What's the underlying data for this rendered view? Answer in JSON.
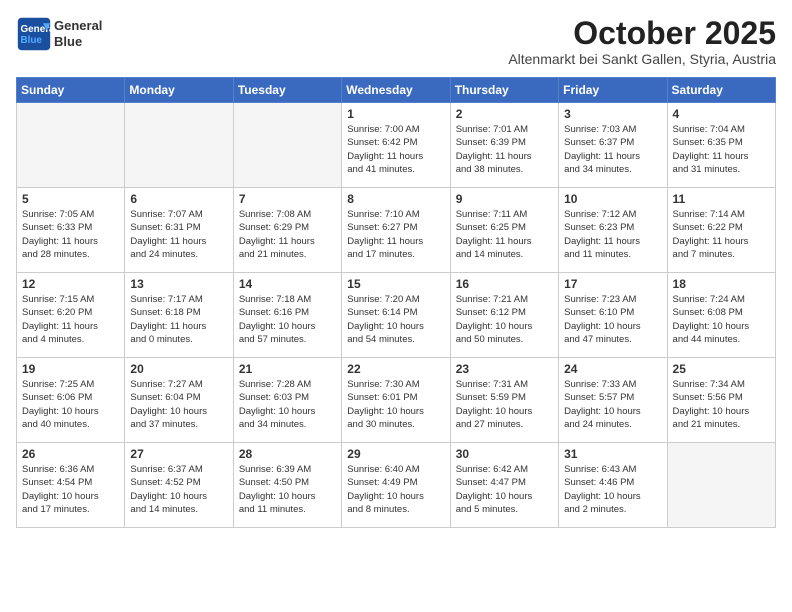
{
  "header": {
    "logo_line1": "General",
    "logo_line2": "Blue",
    "month_year": "October 2025",
    "location": "Altenmarkt bei Sankt Gallen, Styria, Austria"
  },
  "weekdays": [
    "Sunday",
    "Monday",
    "Tuesday",
    "Wednesday",
    "Thursday",
    "Friday",
    "Saturday"
  ],
  "weeks": [
    [
      {
        "day": "",
        "info": ""
      },
      {
        "day": "",
        "info": ""
      },
      {
        "day": "",
        "info": ""
      },
      {
        "day": "1",
        "info": "Sunrise: 7:00 AM\nSunset: 6:42 PM\nDaylight: 11 hours\nand 41 minutes."
      },
      {
        "day": "2",
        "info": "Sunrise: 7:01 AM\nSunset: 6:39 PM\nDaylight: 11 hours\nand 38 minutes."
      },
      {
        "day": "3",
        "info": "Sunrise: 7:03 AM\nSunset: 6:37 PM\nDaylight: 11 hours\nand 34 minutes."
      },
      {
        "day": "4",
        "info": "Sunrise: 7:04 AM\nSunset: 6:35 PM\nDaylight: 11 hours\nand 31 minutes."
      }
    ],
    [
      {
        "day": "5",
        "info": "Sunrise: 7:05 AM\nSunset: 6:33 PM\nDaylight: 11 hours\nand 28 minutes."
      },
      {
        "day": "6",
        "info": "Sunrise: 7:07 AM\nSunset: 6:31 PM\nDaylight: 11 hours\nand 24 minutes."
      },
      {
        "day": "7",
        "info": "Sunrise: 7:08 AM\nSunset: 6:29 PM\nDaylight: 11 hours\nand 21 minutes."
      },
      {
        "day": "8",
        "info": "Sunrise: 7:10 AM\nSunset: 6:27 PM\nDaylight: 11 hours\nand 17 minutes."
      },
      {
        "day": "9",
        "info": "Sunrise: 7:11 AM\nSunset: 6:25 PM\nDaylight: 11 hours\nand 14 minutes."
      },
      {
        "day": "10",
        "info": "Sunrise: 7:12 AM\nSunset: 6:23 PM\nDaylight: 11 hours\nand 11 minutes."
      },
      {
        "day": "11",
        "info": "Sunrise: 7:14 AM\nSunset: 6:22 PM\nDaylight: 11 hours\nand 7 minutes."
      }
    ],
    [
      {
        "day": "12",
        "info": "Sunrise: 7:15 AM\nSunset: 6:20 PM\nDaylight: 11 hours\nand 4 minutes."
      },
      {
        "day": "13",
        "info": "Sunrise: 7:17 AM\nSunset: 6:18 PM\nDaylight: 11 hours\nand 0 minutes."
      },
      {
        "day": "14",
        "info": "Sunrise: 7:18 AM\nSunset: 6:16 PM\nDaylight: 10 hours\nand 57 minutes."
      },
      {
        "day": "15",
        "info": "Sunrise: 7:20 AM\nSunset: 6:14 PM\nDaylight: 10 hours\nand 54 minutes."
      },
      {
        "day": "16",
        "info": "Sunrise: 7:21 AM\nSunset: 6:12 PM\nDaylight: 10 hours\nand 50 minutes."
      },
      {
        "day": "17",
        "info": "Sunrise: 7:23 AM\nSunset: 6:10 PM\nDaylight: 10 hours\nand 47 minutes."
      },
      {
        "day": "18",
        "info": "Sunrise: 7:24 AM\nSunset: 6:08 PM\nDaylight: 10 hours\nand 44 minutes."
      }
    ],
    [
      {
        "day": "19",
        "info": "Sunrise: 7:25 AM\nSunset: 6:06 PM\nDaylight: 10 hours\nand 40 minutes."
      },
      {
        "day": "20",
        "info": "Sunrise: 7:27 AM\nSunset: 6:04 PM\nDaylight: 10 hours\nand 37 minutes."
      },
      {
        "day": "21",
        "info": "Sunrise: 7:28 AM\nSunset: 6:03 PM\nDaylight: 10 hours\nand 34 minutes."
      },
      {
        "day": "22",
        "info": "Sunrise: 7:30 AM\nSunset: 6:01 PM\nDaylight: 10 hours\nand 30 minutes."
      },
      {
        "day": "23",
        "info": "Sunrise: 7:31 AM\nSunset: 5:59 PM\nDaylight: 10 hours\nand 27 minutes."
      },
      {
        "day": "24",
        "info": "Sunrise: 7:33 AM\nSunset: 5:57 PM\nDaylight: 10 hours\nand 24 minutes."
      },
      {
        "day": "25",
        "info": "Sunrise: 7:34 AM\nSunset: 5:56 PM\nDaylight: 10 hours\nand 21 minutes."
      }
    ],
    [
      {
        "day": "26",
        "info": "Sunrise: 6:36 AM\nSunset: 4:54 PM\nDaylight: 10 hours\nand 17 minutes."
      },
      {
        "day": "27",
        "info": "Sunrise: 6:37 AM\nSunset: 4:52 PM\nDaylight: 10 hours\nand 14 minutes."
      },
      {
        "day": "28",
        "info": "Sunrise: 6:39 AM\nSunset: 4:50 PM\nDaylight: 10 hours\nand 11 minutes."
      },
      {
        "day": "29",
        "info": "Sunrise: 6:40 AM\nSunset: 4:49 PM\nDaylight: 10 hours\nand 8 minutes."
      },
      {
        "day": "30",
        "info": "Sunrise: 6:42 AM\nSunset: 4:47 PM\nDaylight: 10 hours\nand 5 minutes."
      },
      {
        "day": "31",
        "info": "Sunrise: 6:43 AM\nSunset: 4:46 PM\nDaylight: 10 hours\nand 2 minutes."
      },
      {
        "day": "",
        "info": ""
      }
    ]
  ]
}
